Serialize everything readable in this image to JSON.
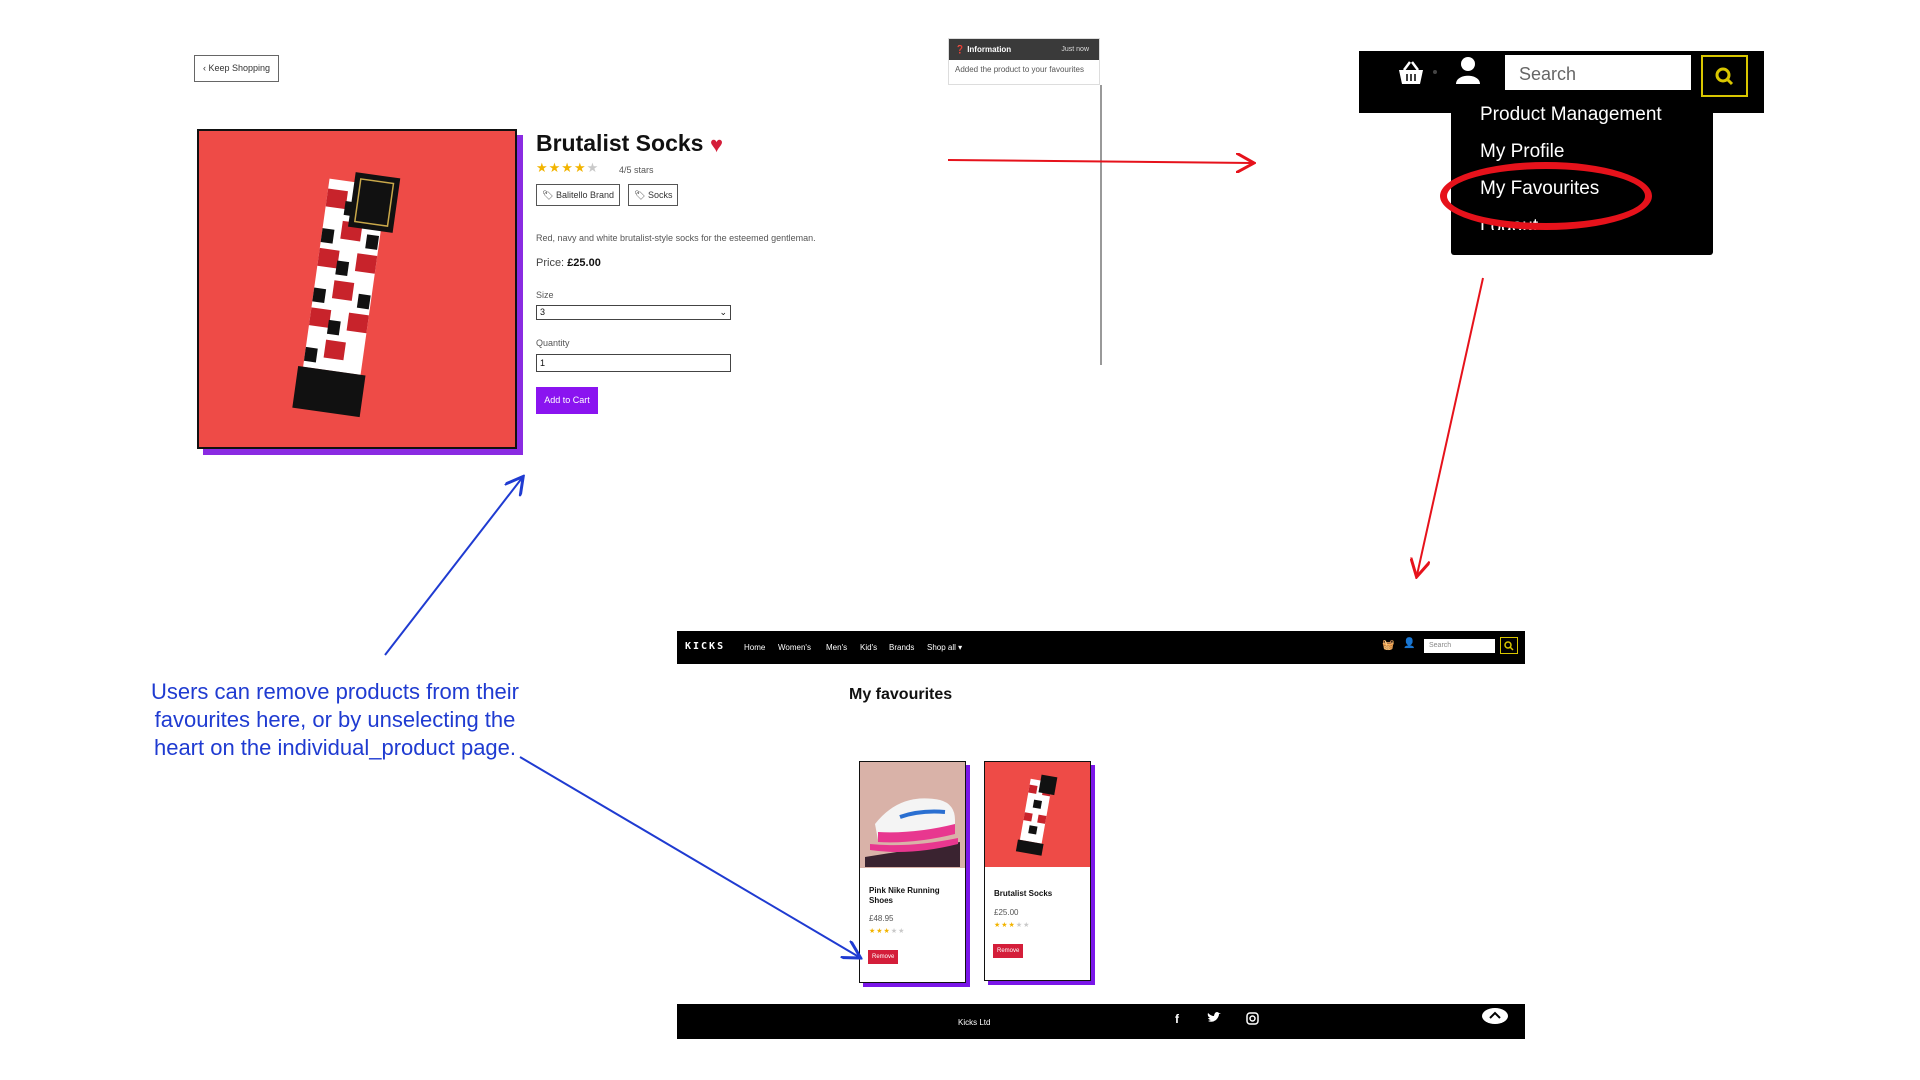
{
  "product_page": {
    "keep_shopping": "Keep Shopping",
    "title": "Brutalist Socks",
    "rating_text": "4/5 stars",
    "tags": [
      "Balitello Brand",
      "Socks"
    ],
    "description": "Red, navy and white brutalist-style socks for the esteemed gentleman.",
    "price_label": "Price:",
    "price_value": "£25.00",
    "size_label": "Size",
    "size_value": "3",
    "quantity_label": "Quantity",
    "quantity_value": "1",
    "add_to_cart": "Add to Cart",
    "rating": 4,
    "heart_color": "#d41e3a",
    "accent_color": "#8a14f0"
  },
  "toast": {
    "title": "Information",
    "time": "Just now",
    "message": "Added the product to your favourites"
  },
  "zoom_menu": {
    "search_placeholder": "Search",
    "items": [
      "Product Management",
      "My Profile",
      "My Favourites",
      "Logout"
    ],
    "highlighted": "My Favourites"
  },
  "fav_page": {
    "logo": "KICKS",
    "nav": [
      "Home",
      "Women's",
      "Men's",
      "Kid's",
      "Brands",
      "Shop all ▾"
    ],
    "search_placeholder": "Search",
    "title": "My favourites",
    "cards": [
      {
        "name": "Pink Nike Running Shoes",
        "price": "£48.95",
        "rating": 3,
        "remove": "Remove"
      },
      {
        "name": "Brutalist Socks",
        "price": "£25.00",
        "rating": 3,
        "remove": "Remove"
      }
    ],
    "footer": "Kicks Ltd",
    "social_icons": [
      "facebook-icon",
      "twitter-icon",
      "instagram-icon"
    ]
  },
  "annotation": {
    "text": "Users can remove products from their favourites here, or by unselecting the heart on the individual_product page."
  }
}
